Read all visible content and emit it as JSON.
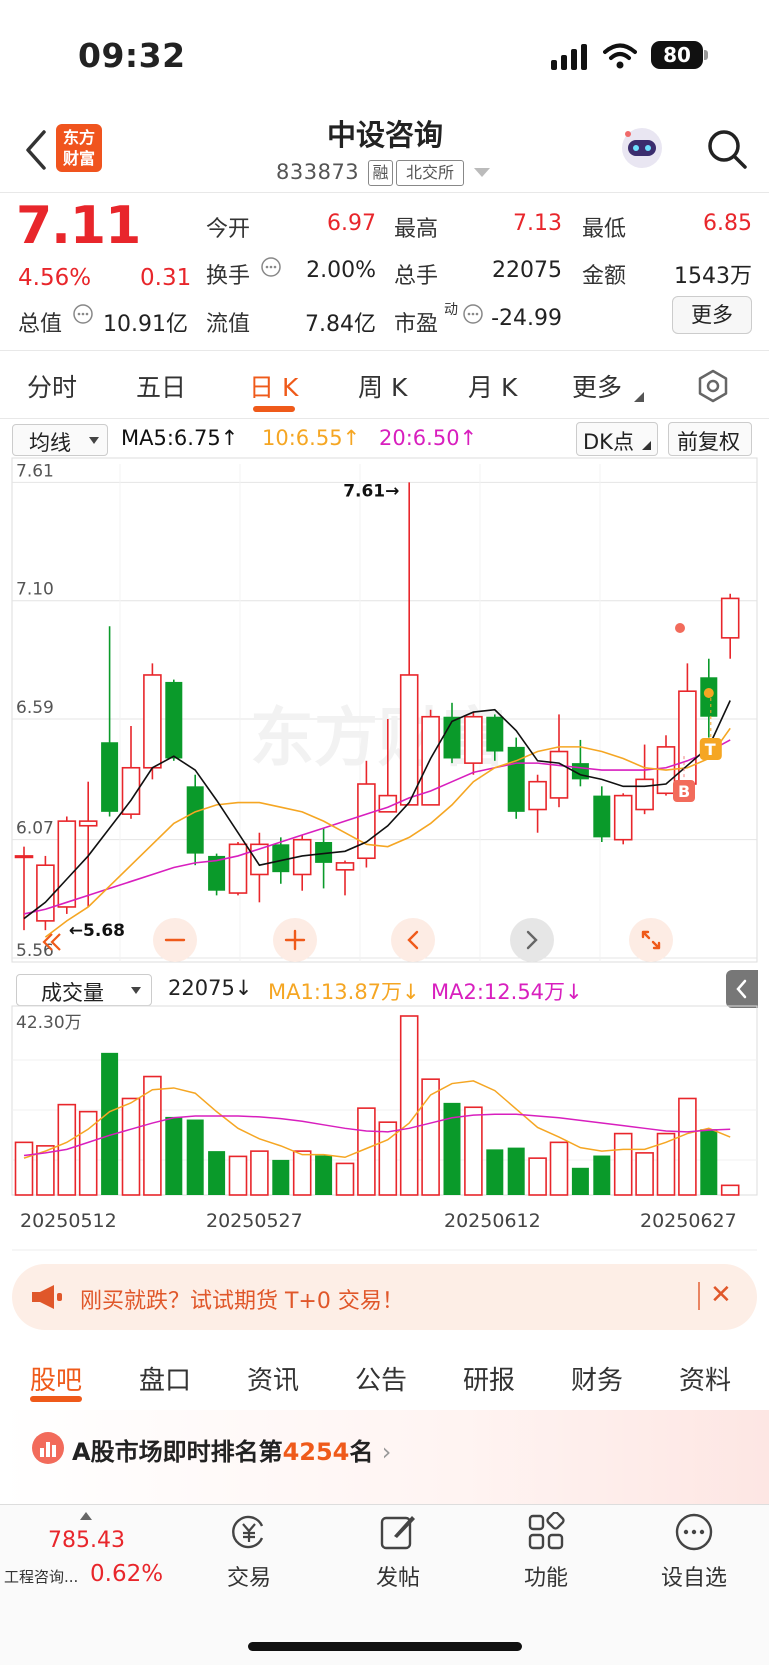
{
  "status_bar": {
    "time": "09:32",
    "battery": "80"
  },
  "header": {
    "logo_line1": "东方",
    "logo_line2": "财富",
    "stock_name": "中设咨询",
    "stock_code": "833873",
    "tag_margin": "融",
    "tag_exchange": "北交所"
  },
  "quote": {
    "price": "7.11",
    "change_pct": "4.56%",
    "change_amt": "0.31",
    "open_label": "今开",
    "open": "6.97",
    "high_label": "最高",
    "high": "7.13",
    "low_label": "最低",
    "low": "6.85",
    "turnover_label": "换手",
    "turnover": "2.00%",
    "volume_label": "总手",
    "volume": "22075",
    "amount_label": "金额",
    "amount": "1543万",
    "mktcap_label": "总值",
    "mktcap": "10.91亿",
    "float_label": "流值",
    "float": "7.84亿",
    "pe_label": "市盈",
    "pe_sup": "动",
    "pe": "-24.99",
    "more_label": "更多"
  },
  "period_tabs": [
    "分时",
    "五日",
    "日 K",
    "周 K",
    "月 K",
    "更多"
  ],
  "indicators": {
    "ma_select": "均线",
    "ma5": "MA5:6.75↑",
    "ma10": "10:6.55↑",
    "ma20": "20:6.50↑",
    "dk_label": "DK点",
    "adjust_label": "前复权",
    "vol_select": "成交量",
    "vol_value": "22075↓",
    "vol_ma1": "MA1:13.87万↓",
    "vol_ma2": "MA2:12.54万↓"
  },
  "chart_data": {
    "type": "candlestick",
    "y_ticks": [
      "7.61",
      "7.10",
      "6.59",
      "6.07",
      "5.56"
    ],
    "ylim": [
      5.56,
      7.61
    ],
    "max_label": "7.61→",
    "min_label": "←5.68",
    "vol_max_label": "42.30万",
    "x_ticks": [
      "20250512",
      "20250527",
      "20250612",
      "20250627"
    ],
    "marker_b": "B",
    "marker_t": "T",
    "candles": [
      [
        6.0,
        6.0,
        6.04,
        5.68
      ],
      [
        5.72,
        5.96,
        6.0,
        5.68
      ],
      [
        5.78,
        6.15,
        6.17,
        5.75
      ],
      [
        6.13,
        6.15,
        6.32,
        5.78
      ],
      [
        6.49,
        6.19,
        6.99,
        6.17
      ],
      [
        6.18,
        6.38,
        6.56,
        6.16
      ],
      [
        6.38,
        6.78,
        6.83,
        6.33
      ],
      [
        6.75,
        6.42,
        6.76,
        6.41
      ],
      [
        6.3,
        6.01,
        6.35,
        5.96
      ],
      [
        6.0,
        5.85,
        6.01,
        5.83
      ],
      [
        5.84,
        6.05,
        6.06,
        5.83
      ],
      [
        5.92,
        6.05,
        6.1,
        5.8
      ],
      [
        6.05,
        5.93,
        6.08,
        5.88
      ],
      [
        5.92,
        6.07,
        6.09,
        5.85
      ],
      [
        6.06,
        5.97,
        6.12,
        5.86
      ],
      [
        5.94,
        5.97,
        5.98,
        5.83
      ],
      [
        5.99,
        6.31,
        6.41,
        5.95
      ],
      [
        6.19,
        6.26,
        6.59,
        6.19
      ],
      [
        6.22,
        6.78,
        7.61,
        6.22
      ],
      [
        6.22,
        6.6,
        6.63,
        6.22
      ],
      [
        6.6,
        6.42,
        6.66,
        6.4
      ],
      [
        6.4,
        6.6,
        6.62,
        6.35
      ],
      [
        6.6,
        6.45,
        6.61,
        6.41
      ],
      [
        6.47,
        6.19,
        6.51,
        6.16
      ],
      [
        6.2,
        6.32,
        6.35,
        6.1
      ],
      [
        6.25,
        6.45,
        6.61,
        6.21
      ],
      [
        6.4,
        6.33,
        6.5,
        6.3
      ],
      [
        6.26,
        6.08,
        6.3,
        6.06
      ],
      [
        6.07,
        6.26,
        6.27,
        6.05
      ],
      [
        6.2,
        6.33,
        6.48,
        6.18
      ],
      [
        6.27,
        6.47,
        6.52,
        6.26
      ],
      [
        6.31,
        6.71,
        6.83,
        6.29
      ],
      [
        6.77,
        6.6,
        6.85,
        6.51
      ],
      [
        6.94,
        7.11,
        7.13,
        6.85
      ]
    ],
    "volumes": [
      6.0,
      5.6,
      10.3,
      9.5,
      16.2,
      11.0,
      13.5,
      8.9,
      8.6,
      5.0,
      4.4,
      5.0,
      4.0,
      5.0,
      4.5,
      3.6,
      9.9,
      8.3,
      20.4,
      13.2,
      10.5,
      10.0,
      5.2,
      5.4,
      4.2,
      6.0,
      3.1,
      4.5,
      7.0,
      4.8,
      7.0,
      11.0,
      7.5,
      1.1
    ],
    "vol_ylim": [
      0,
      20.4
    ],
    "ma5": [
      5.73,
      5.8,
      5.9,
      6.0,
      6.12,
      6.24,
      6.38,
      6.43,
      6.37,
      6.24,
      6.1,
      5.96,
      5.98,
      6.0,
      6.01,
      6.02,
      6.06,
      6.13,
      6.23,
      6.42,
      6.58,
      6.62,
      6.63,
      6.54,
      6.41,
      6.4,
      6.35,
      6.33,
      6.3,
      6.3,
      6.31,
      6.39,
      6.47,
      6.67
    ],
    "ma10": [
      null,
      5.65,
      5.72,
      5.78,
      5.87,
      5.96,
      6.05,
      6.14,
      6.19,
      6.22,
      6.23,
      6.23,
      6.21,
      6.19,
      6.15,
      6.1,
      6.05,
      6.04,
      6.08,
      6.14,
      6.22,
      6.32,
      6.38,
      6.41,
      6.45,
      6.47,
      6.47,
      6.45,
      6.42,
      6.38,
      6.37,
      6.38,
      6.42,
      6.55
    ],
    "ma20": [
      5.75,
      5.77,
      5.8,
      5.83,
      5.86,
      5.89,
      5.92,
      5.95,
      5.97,
      5.98,
      6.0,
      6.03,
      6.06,
      6.09,
      6.12,
      6.15,
      6.18,
      6.21,
      6.25,
      6.28,
      6.32,
      6.36,
      6.38,
      6.4,
      6.4,
      6.39,
      6.38,
      6.37,
      6.37,
      6.37,
      6.38,
      6.41,
      6.45,
      6.5
    ],
    "vol_ma1": [
      4.2,
      5.0,
      6.0,
      7.5,
      9.5,
      10.5,
      12.0,
      12.2,
      11.6,
      9.5,
      7.6,
      6.4,
      5.6,
      4.6,
      4.6,
      4.3,
      5.3,
      6.3,
      8.2,
      11.4,
      12.7,
      13.0,
      11.9,
      9.8,
      7.7,
      6.6,
      5.4,
      5.0,
      5.2,
      5.2,
      6.0,
      7.0,
      7.6,
      6.6
    ],
    "vol_ma2": [
      4.5,
      4.8,
      5.2,
      6.0,
      6.8,
      7.5,
      8.2,
      8.8,
      9.0,
      9.0,
      9.0,
      8.9,
      8.7,
      8.4,
      8.0,
      7.6,
      7.3,
      7.2,
      7.6,
      8.2,
      8.8,
      9.1,
      9.2,
      9.2,
      9.0,
      8.8,
      8.5,
      8.2,
      7.9,
      7.6,
      7.3,
      7.2,
      7.4,
      7.5
    ]
  },
  "ad": {
    "text": "刚买就跌？试试期货 T+0 交易！"
  },
  "section_tabs": [
    "股吧",
    "盘口",
    "资讯",
    "公告",
    "研报",
    "财务",
    "资料"
  ],
  "ranking": {
    "prefix": "A股市场即时排名第",
    "rank": "4254",
    "suffix": "名"
  },
  "bottom_nav": {
    "index_value": "785.43",
    "index_name": "工程咨询...",
    "index_change": "0.62%",
    "items": [
      "交易",
      "发帖",
      "功能",
      "设自选"
    ]
  },
  "colors": {
    "up": "#e8262b",
    "down": "#0a9a2a",
    "ma5": "#111111",
    "ma10": "#f5a623",
    "ma20": "#d81fbe",
    "accent": "#ef5a1a"
  }
}
